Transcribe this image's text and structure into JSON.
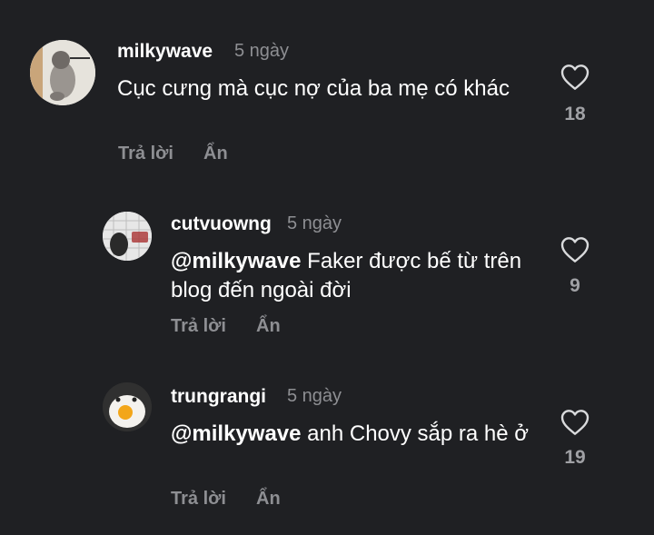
{
  "colors": {
    "background": "#1f2023",
    "text_primary": "#ffffff",
    "text_secondary": "#8e8f93"
  },
  "comments": [
    {
      "username": "milkywave",
      "time": "5 ngày",
      "text": "Cục cưng mà cục nợ của ba mẹ có khác",
      "reply_label": "Trả lời",
      "hide_label": "Ẩn",
      "likes": "18",
      "like_icon": "heart-outline-icon"
    },
    {
      "username": "cutvuowng",
      "time": "5 ngày",
      "mention": "@milkywave",
      "text": " Faker được bế từ trên blog đến ngoài đời",
      "reply_label": "Trả lời",
      "hide_label": "Ẩn",
      "likes": "9",
      "like_icon": "heart-outline-icon"
    },
    {
      "username": "trungrangi",
      "time": "5 ngày",
      "mention": "@milkywave",
      "text": " anh Chovy sắp ra hè ở",
      "reply_label": "Trả lời",
      "hide_label": "Ẩn",
      "likes": "19",
      "like_icon": "heart-outline-icon"
    }
  ]
}
